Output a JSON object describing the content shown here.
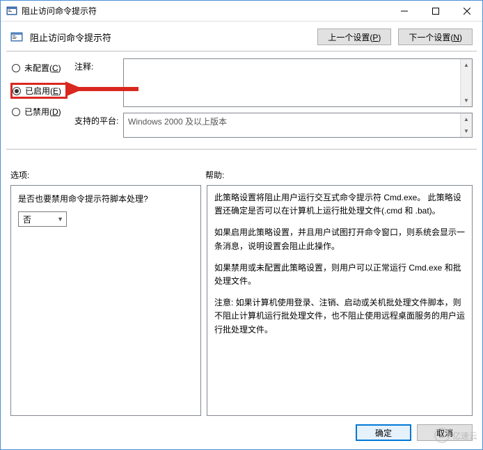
{
  "window": {
    "title": "阻止访问命令提示符"
  },
  "header": {
    "title": "阻止访问命令提示符",
    "prev_button": "上一个设置(P)",
    "next_button": "下一个设置(N)"
  },
  "radios": {
    "not_configured": "未配置(C)",
    "enabled": "已启用(E)",
    "disabled": "已禁用(D)",
    "selected": "enabled"
  },
  "fields": {
    "comment_label": "注释:",
    "comment_value": "",
    "platform_label": "支持的平台:",
    "platform_value": "Windows 2000 及以上版本"
  },
  "sections": {
    "options_label": "选项:",
    "help_label": "帮助:"
  },
  "options": {
    "question": "是否也要禁用命令提示符脚本处理?",
    "select_value": "否"
  },
  "help": {
    "p1": "此策略设置将阻止用户运行交互式命令提示符 Cmd.exe。 此策略设置还确定是否可以在计算机上运行批处理文件(.cmd 和 .bat)。",
    "p2": "如果启用此策略设置，并且用户试图打开命令窗口，则系统会显示一条消息，说明设置会阻止此操作。",
    "p3": "如果禁用或未配置此策略设置，则用户可以正常运行 Cmd.exe 和批处理文件。",
    "p4": "注意: 如果计算机使用登录、注销、启动或关机批处理文件脚本，则不阻止计算机运行批处理文件，也不阻止使用远程桌面服务的用户运行批处理文件。"
  },
  "footer": {
    "ok": "确定",
    "cancel": "取消"
  },
  "watermark": {
    "text": "亿速云"
  }
}
